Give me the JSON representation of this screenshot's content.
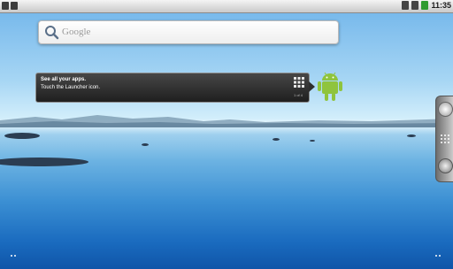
{
  "status_bar": {
    "time": "11:35"
  },
  "search": {
    "placeholder": "Google"
  },
  "hint_bubble": {
    "title": "See all your apps.",
    "subtitle": "Touch the Launcher icon.",
    "page": "1 of 4"
  },
  "icons": {
    "search": "magnifier-icon",
    "launcher": "app-grid-icon",
    "android": "android-robot-icon",
    "dock_top": "phone-icon",
    "dock_middle": "all-apps-icon",
    "dock_bottom": "browser-icon"
  },
  "colors": {
    "accent_green": "#2f9b31",
    "android_green": "#8fc43d"
  }
}
